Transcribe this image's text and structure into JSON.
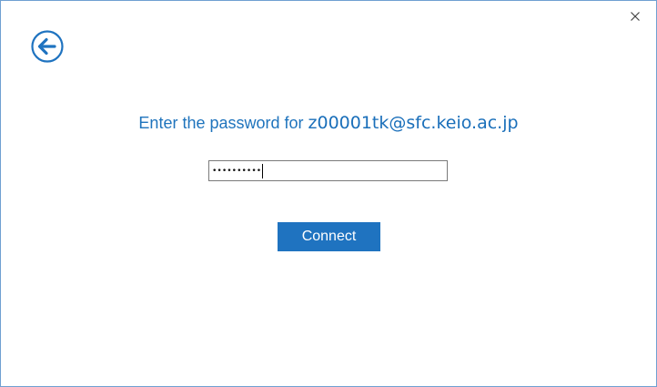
{
  "dialog": {
    "prompt_prefix": "Enter the password for ",
    "account_email": "z00001tk@sfc.keio.ac.jp",
    "password_masked": "••••••••••",
    "connect_label": "Connect"
  },
  "icons": {
    "back": "back-arrow-icon",
    "close": "close-icon"
  },
  "colors": {
    "accent": "#1f73c0",
    "prompt_text": "#1f74bd",
    "border": "#6fa0d2"
  }
}
